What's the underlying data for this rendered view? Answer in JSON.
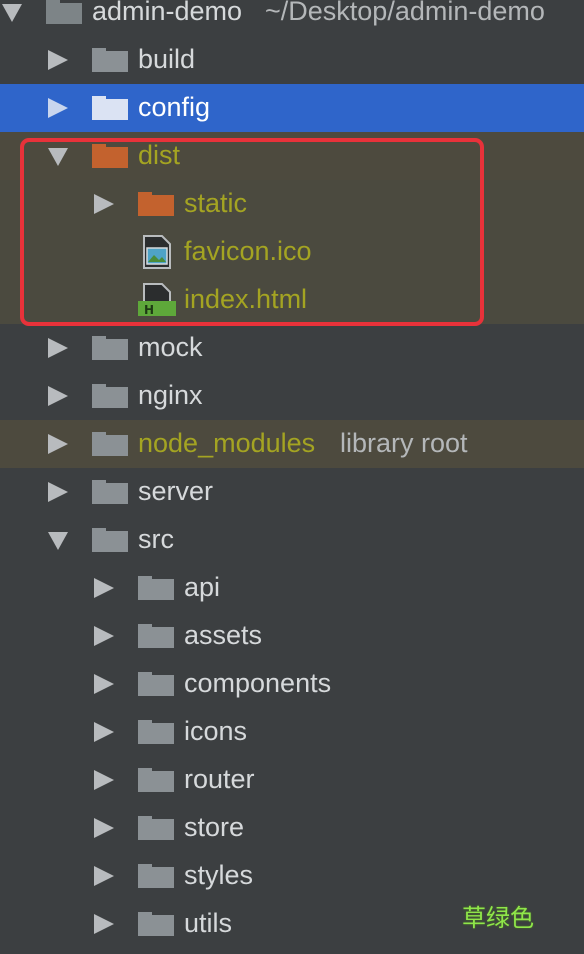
{
  "project": {
    "name": "admin-demo",
    "path": "~/Desktop/admin-demo"
  },
  "tree": {
    "build": "build",
    "config": "config",
    "dist": "dist",
    "dist_static": "static",
    "dist_favicon": "favicon.ico",
    "dist_index": "index.html",
    "mock": "mock",
    "nginx": "nginx",
    "node_modules": "node_modules",
    "node_modules_hint": "library root",
    "server": "server",
    "src": "src",
    "src_api": "api",
    "src_assets": "assets",
    "src_components": "components",
    "src_icons": "icons",
    "src_router": "router",
    "src_store": "store",
    "src_styles": "styles",
    "src_utils": "utils"
  },
  "watermark": "草绿色",
  "colors": {
    "background": "#3c3f41",
    "selection": "#2f65ca",
    "excluded_background": "#4d4a3e",
    "excluded_text": "#a4a422",
    "folder_grey": "#8b9195",
    "folder_orange": "#c3622e",
    "highlight_border": "#e8323a"
  },
  "icons": {
    "collapsed": "triangle-right-icon",
    "expanded": "triangle-down-icon",
    "folder": "folder-icon",
    "image_file": "image-file-icon",
    "html_file": "html-file-icon"
  }
}
